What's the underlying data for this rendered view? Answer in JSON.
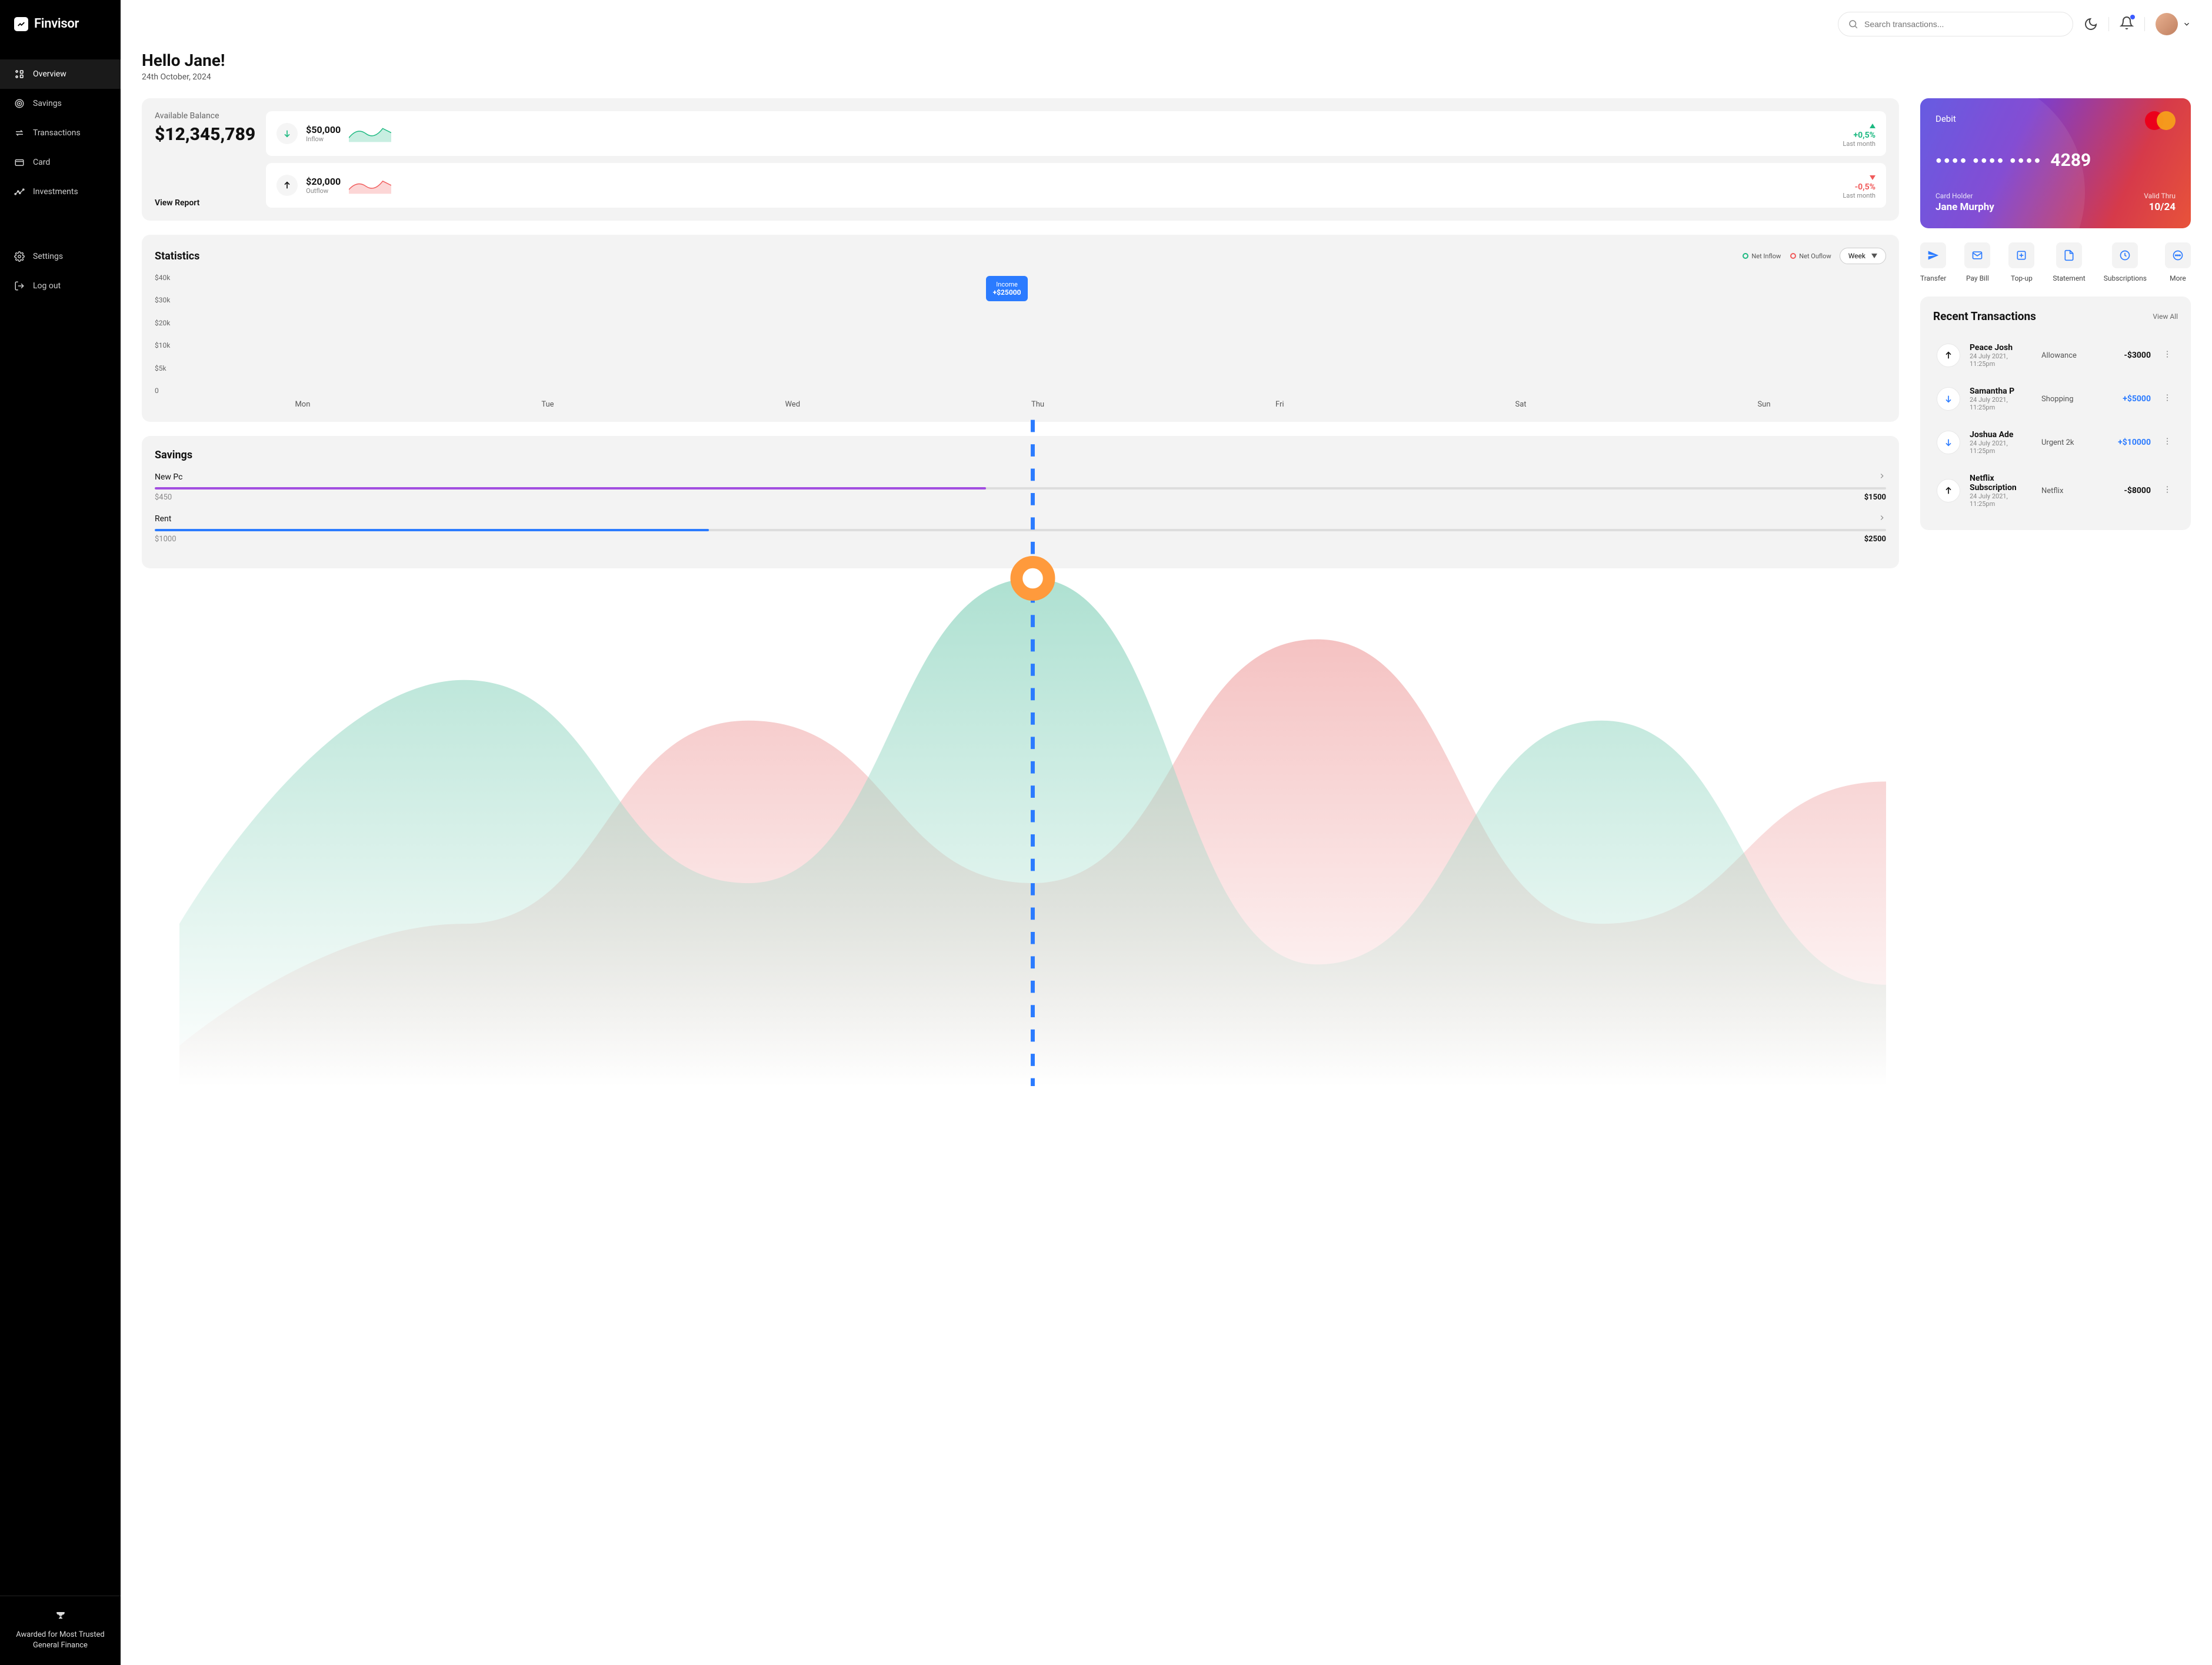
{
  "brand": "Finvisor",
  "nav": {
    "items": [
      {
        "label": "Overview",
        "active": true
      },
      {
        "label": "Savings"
      },
      {
        "label": "Transactions"
      },
      {
        "label": "Card"
      },
      {
        "label": "Investments"
      }
    ],
    "secondary": [
      {
        "label": "Settings"
      },
      {
        "label": "Log out"
      }
    ]
  },
  "sidebar_footer": "Awarded for Most Trusted General Finance",
  "search": {
    "placeholder": "Search transactions..."
  },
  "greeting": {
    "title": "Hello Jane!",
    "date": "24th October, 2024"
  },
  "balance": {
    "label": "Available Balance",
    "value": "$12,345,789",
    "view_report": "View Report",
    "inflow": {
      "amount": "$50,000",
      "label": "Inflow",
      "change": "+0,5%",
      "sub": "Last month"
    },
    "outflow": {
      "amount": "$20,000",
      "label": "Outflow",
      "change": "-0,5%",
      "sub": "Last month"
    }
  },
  "stats": {
    "title": "Statistics",
    "legend": {
      "inflow": "Net Inflow",
      "outflow": "Net Ouflow"
    },
    "period": "Week",
    "tooltip": {
      "label": "Income",
      "value": "+$25000"
    },
    "ylabels": [
      "$40k",
      "$30k",
      "$20k",
      "$10k",
      "$5k",
      "0"
    ],
    "xlabels": [
      "Mon",
      "Tue",
      "Wed",
      "Thu",
      "Fri",
      "Sat",
      "Sun"
    ]
  },
  "chart_data": {
    "type": "area",
    "title": "Statistics",
    "xlabel": "",
    "ylabel": "",
    "ylim": [
      0,
      40000
    ],
    "categories": [
      "Mon",
      "Tue",
      "Wed",
      "Thu",
      "Fri",
      "Sat",
      "Sun"
    ],
    "series": [
      {
        "name": "Net Inflow",
        "color": "#71cfb4",
        "values": [
          8000,
          20000,
          10000,
          25000,
          6000,
          18000,
          5000
        ]
      },
      {
        "name": "Net Outflow",
        "color": "#f29a9a",
        "values": [
          2000,
          8000,
          18000,
          10000,
          22000,
          8000,
          15000
        ]
      }
    ],
    "highlight": {
      "x": "Thu",
      "label": "Income",
      "value": 25000
    }
  },
  "savings": {
    "title": "Savings",
    "items": [
      {
        "name": "New Pc",
        "current": "$450",
        "target": "$1500",
        "pct": 48,
        "color": "#a24ee0"
      },
      {
        "name": "Rent",
        "current": "$1000",
        "target": "$2500",
        "pct": 32,
        "color": "#2b7bff"
      }
    ]
  },
  "card": {
    "type": "Debit",
    "masked": "●●●● ●●●● ●●●●",
    "last4": "4289",
    "holder_label": "Card Holder",
    "holder": "Jane Murphy",
    "valid_label": "Valid Thru",
    "valid": "10/24"
  },
  "actions": [
    {
      "label": "Transfer"
    },
    {
      "label": "Pay Bill"
    },
    {
      "label": "Top-up"
    },
    {
      "label": "Statement"
    },
    {
      "label": "Subscriptions"
    },
    {
      "label": "More"
    }
  ],
  "transactions": {
    "title": "Recent Transactions",
    "view_all": "View All",
    "items": [
      {
        "name": "Peace Josh",
        "time": "24 July 2021, 11:25pm",
        "category": "Allowance",
        "amount": "-$3000",
        "direction": "out"
      },
      {
        "name": "Samantha P",
        "time": "24 July 2021, 11:25pm",
        "category": "Shopping",
        "amount": "+$5000",
        "direction": "in"
      },
      {
        "name": "Joshua Ade",
        "time": "24 July 2021, 11:25pm",
        "category": "Urgent 2k",
        "amount": "+$10000",
        "direction": "in"
      },
      {
        "name": "Netflix Subscription",
        "time": "24 July 2021, 11:25pm",
        "category": "Netflix",
        "amount": "-$8000",
        "direction": "out"
      }
    ]
  }
}
